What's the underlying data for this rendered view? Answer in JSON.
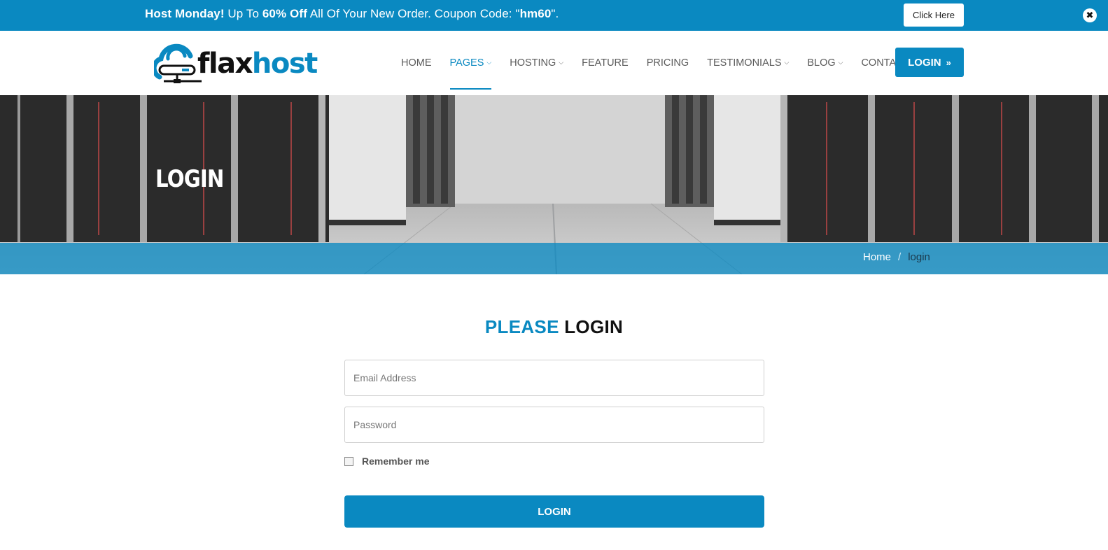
{
  "promo": {
    "bold_lead": "Host Monday!",
    "text_1": " Up To ",
    "discount": "60% Off",
    "text_2": " All Of Your New Order. Coupon Code: \"",
    "code": "hm60",
    "text_3": "\".",
    "button_label": "Click Here",
    "close_icon": "close-icon"
  },
  "logo": {
    "part1": "flax",
    "part2": "host"
  },
  "nav": {
    "items": [
      {
        "label": "HOME",
        "caret": false,
        "active": false
      },
      {
        "label": "PAGES",
        "caret": true,
        "active": true
      },
      {
        "label": "HOSTING",
        "caret": true,
        "active": false
      },
      {
        "label": "FEATURE",
        "caret": false,
        "active": false
      },
      {
        "label": "PRICING",
        "caret": false,
        "active": false
      },
      {
        "label": "TESTIMONIALS",
        "caret": true,
        "active": false
      },
      {
        "label": "BLOG",
        "caret": true,
        "active": false
      },
      {
        "label": "CONTACT",
        "caret": false,
        "active": false
      }
    ],
    "login_label": "LOGIN"
  },
  "banner": {
    "title": "LOGIN",
    "breadcrumb_home": "Home",
    "breadcrumb_sep": "/",
    "breadcrumb_current": "login"
  },
  "form": {
    "title_1": "PLEASE",
    "title_2": "LOGIN",
    "email_placeholder": "Email Address",
    "password_placeholder": "Password",
    "remember_label": "Remember me",
    "submit_label": "LOGIN"
  },
  "colors": {
    "accent": "#0a89c1"
  }
}
